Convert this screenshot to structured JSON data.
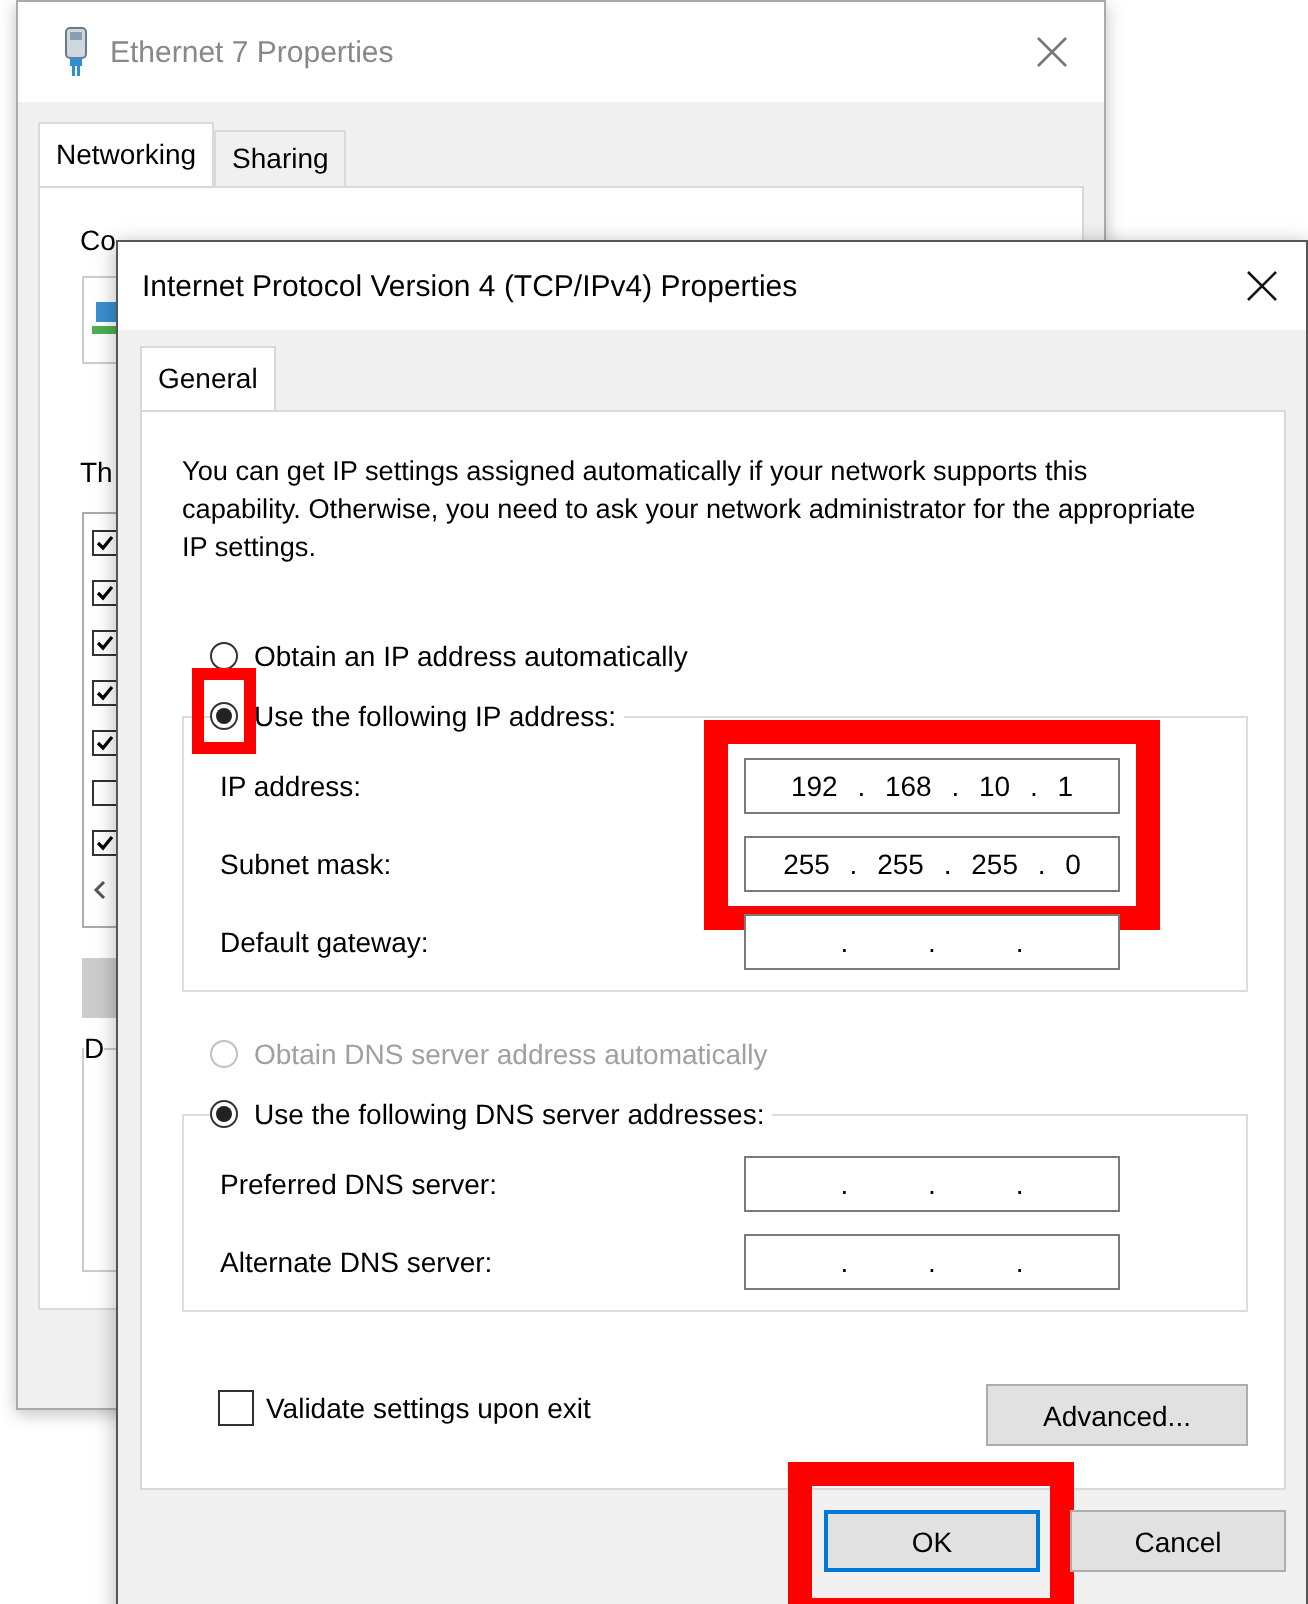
{
  "back_window": {
    "title": "Ethernet 7 Properties",
    "tabs": [
      {
        "label": "Networking",
        "selected": true
      },
      {
        "label": "Sharing",
        "selected": false
      }
    ],
    "connect_label": "Co",
    "components_label": "Th",
    "description_label": "D",
    "components": [
      {
        "checked": true
      },
      {
        "checked": true
      },
      {
        "checked": true
      },
      {
        "checked": true
      },
      {
        "checked": true
      },
      {
        "checked": false
      },
      {
        "checked": true
      }
    ]
  },
  "dialog": {
    "title": "Internet Protocol Version 4 (TCP/IPv4) Properties",
    "tabs": [
      {
        "label": "General",
        "selected": true
      }
    ],
    "intro": "You can get IP settings assigned automatically if your network supports this capability. Otherwise, you need to ask your network administrator for the appropriate IP settings.",
    "ip_options": [
      {
        "label": "Obtain an IP address automatically",
        "selected": false,
        "disabled": false,
        "highlighted": false
      },
      {
        "label": "Use the following IP address:",
        "selected": true,
        "disabled": false,
        "highlighted": true
      }
    ],
    "ip_fields": [
      {
        "label": "IP address:",
        "value": "192 . 168 . 10 . 1",
        "highlighted": true
      },
      {
        "label": "Subnet mask:",
        "value": "255 . 255 . 255 . 0",
        "highlighted": true
      },
      {
        "label": "Default gateway:",
        "value": ". . .",
        "highlighted": false
      }
    ],
    "dns_options": [
      {
        "label": "Obtain DNS server address automatically",
        "selected": false,
        "disabled": true,
        "highlighted": false
      },
      {
        "label": "Use the following DNS server addresses:",
        "selected": true,
        "disabled": false,
        "highlighted": false
      }
    ],
    "dns_fields": [
      {
        "label": "Preferred DNS server:",
        "value": ". . .",
        "highlighted": false
      },
      {
        "label": "Alternate DNS server:",
        "value": ". . .",
        "highlighted": false
      }
    ],
    "validate": {
      "label": "Validate settings upon exit",
      "checked": false
    },
    "advanced_button": "Advanced...",
    "buttons": [
      {
        "label": "OK",
        "default": true,
        "highlighted": true
      },
      {
        "label": "Cancel",
        "default": false,
        "highlighted": false
      }
    ]
  }
}
